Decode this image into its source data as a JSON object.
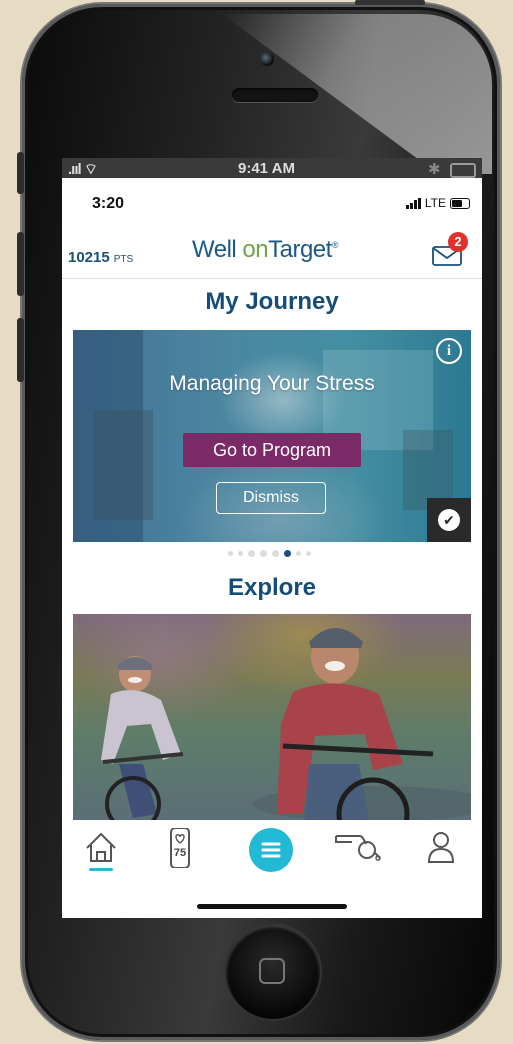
{
  "outer_status": {
    "time": "9:41 AM"
  },
  "inner_status": {
    "time": "3:20",
    "network": "LTE"
  },
  "header": {
    "points": "10215",
    "points_unit": "PTS",
    "logo_part1": "Well ",
    "logo_on": "on",
    "logo_part2": "Target",
    "logo_mark": "®",
    "mail_badge_count": "2"
  },
  "journey": {
    "section_title": "My Journey",
    "card_title": "Managing Your Stress",
    "primary_button": "Go to Program",
    "secondary_button": "Dismiss",
    "info_symbol": "i",
    "check_symbol": "✔",
    "carousel_total": 8,
    "carousel_active_index": 5
  },
  "explore": {
    "section_title": "Explore"
  },
  "bottom_nav": {
    "items": [
      "home-icon",
      "activity-tracker-icon",
      "menu-icon",
      "coach-whistle-icon",
      "profile-icon"
    ],
    "tracker_value": "75",
    "active": "home-icon"
  },
  "colors": {
    "brand_navy": "#1b4f7a",
    "brand_green": "#6ba644",
    "accent_teal": "#22b9d4",
    "primary_button": "#7a2a66",
    "badge_red": "#e0302c"
  }
}
